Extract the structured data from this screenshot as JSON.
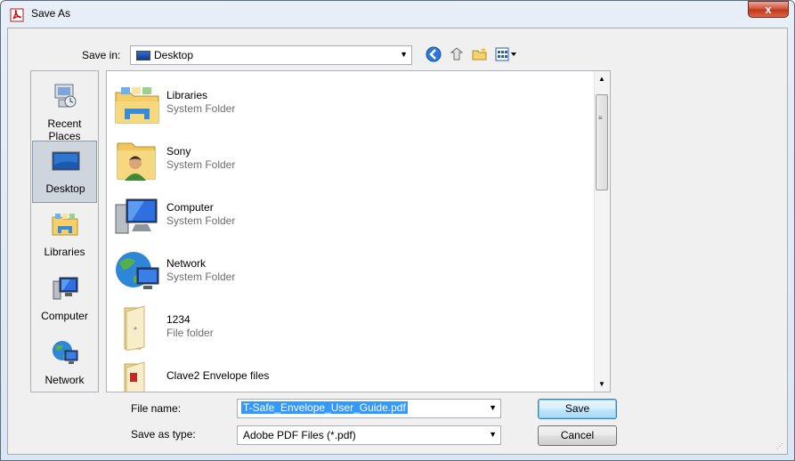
{
  "window": {
    "title": "Save As",
    "close_glyph": "x"
  },
  "toolbar": {
    "save_in_label": "Save in:",
    "save_in_value": "Desktop",
    "buttons": [
      "back-icon",
      "up-folder-icon",
      "new-folder-icon",
      "view-menu-icon"
    ]
  },
  "places": [
    {
      "label": "Recent Places",
      "icon": "recent-places-icon",
      "selected": false
    },
    {
      "label": "Desktop",
      "icon": "desktop-icon",
      "selected": true
    },
    {
      "label": "Libraries",
      "icon": "libraries-icon",
      "selected": false
    },
    {
      "label": "Computer",
      "icon": "computer-icon",
      "selected": false
    },
    {
      "label": "Network",
      "icon": "network-icon",
      "selected": false
    }
  ],
  "files": [
    {
      "name": "Libraries",
      "type": "System Folder",
      "icon": "libraries-folder-icon"
    },
    {
      "name": "Sony",
      "type": "System Folder",
      "icon": "user-folder-icon"
    },
    {
      "name": "Computer",
      "type": "System Folder",
      "icon": "computer-icon"
    },
    {
      "name": "Network",
      "type": "System Folder",
      "icon": "network-icon"
    },
    {
      "name": "1234",
      "type": "File folder",
      "icon": "folder-icon"
    },
    {
      "name": "Clave2 Envelope files",
      "type": "",
      "icon": "folder-icon"
    }
  ],
  "form": {
    "file_name_label": "File name:",
    "file_name_value": "T-Safe_Envelope_User_Guide.pdf",
    "save_type_label": "Save as type:",
    "save_type_value": "Adobe PDF Files (*.pdf)"
  },
  "buttons": {
    "save": "Save",
    "cancel": "Cancel"
  },
  "colors": {
    "selection": "#3399ff",
    "accent": "#3c7fb1",
    "close": "#c2381b"
  }
}
